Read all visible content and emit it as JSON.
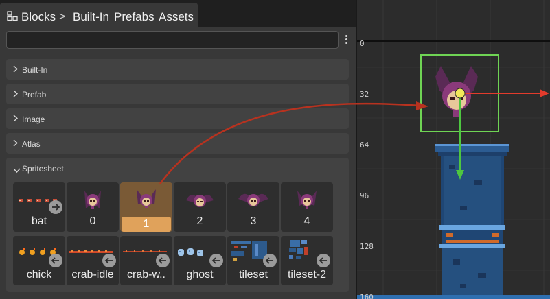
{
  "breadcrumb": {
    "root": "Blocks",
    "separator": ">",
    "items": [
      "Built-In",
      "Prefabs",
      "Assets"
    ]
  },
  "search": {
    "value": "",
    "placeholder": ""
  },
  "sections": [
    {
      "label": "Built-In",
      "expanded": false
    },
    {
      "label": "Prefab",
      "expanded": false
    },
    {
      "label": "Image",
      "expanded": false
    },
    {
      "label": "Atlas",
      "expanded": false
    },
    {
      "label": "Spritesheet",
      "expanded": true
    }
  ],
  "spritesheet": {
    "row1": [
      "bat",
      "0",
      "1",
      "2",
      "3",
      "4"
    ],
    "row2": [
      "chick",
      "crab-idle",
      "crab-w..",
      "ghost",
      "tileset",
      "tileset-2"
    ],
    "selected": "1"
  },
  "ruler": {
    "marks": [
      "0",
      "32",
      "64",
      "96",
      "128",
      "160"
    ]
  },
  "colors": {
    "accent": "#e0a25b",
    "gizmo_x": "#e23b2c",
    "gizmo_y": "#4ec740",
    "selection": "#6fd454",
    "pivot": "#f2e95a",
    "drag_curve": "#b8321f"
  }
}
